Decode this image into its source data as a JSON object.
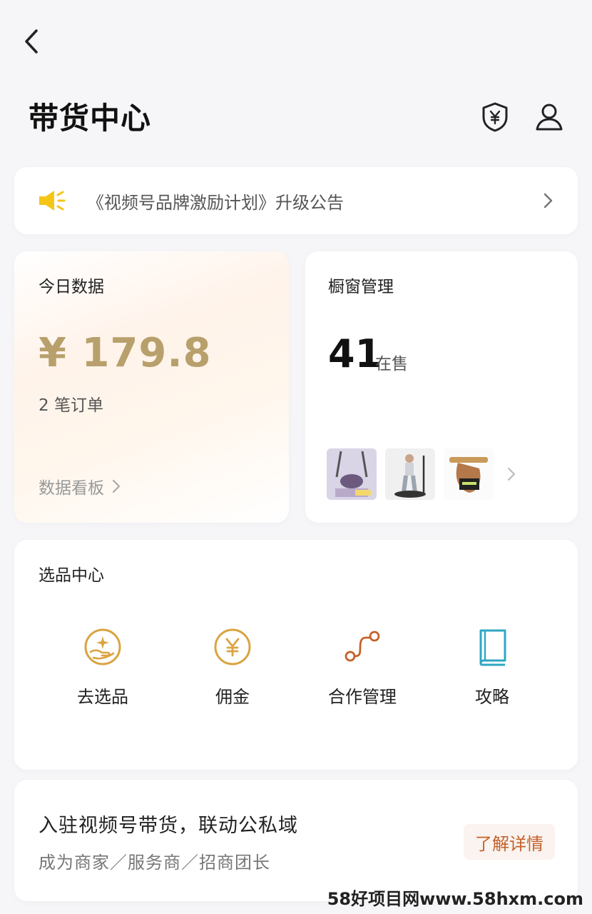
{
  "header": {
    "title": "带货中心"
  },
  "notice": {
    "text": "《视频号品牌激励计划》升级公告"
  },
  "today": {
    "label": "今日数据",
    "amount": "¥ 179.8",
    "orders": "2 笔订单",
    "dashboard_link": "数据看板"
  },
  "window": {
    "label": "橱窗管理",
    "count": "41",
    "count_label": "在售"
  },
  "selection": {
    "label": "选品中心",
    "items": [
      {
        "label": "去选品",
        "icon": "hand-sparkle-icon"
      },
      {
        "label": "佣金",
        "icon": "yen-coin-icon"
      },
      {
        "label": "合作管理",
        "icon": "link-nodes-icon"
      },
      {
        "label": "攻略",
        "icon": "book-icon"
      }
    ]
  },
  "promo": {
    "title": "入驻视频号带货，联动公私域",
    "subtitle": "成为商家／服务商／招商团长",
    "button": "了解详情"
  },
  "watermark": "58好项目网www.58hxm.com",
  "colors": {
    "accent_gold": "#b8a06c",
    "icon_gold": "#d9a441",
    "icon_orange": "#c4622a",
    "icon_teal": "#2ea7c4",
    "notice_yellow": "#f5c518"
  }
}
